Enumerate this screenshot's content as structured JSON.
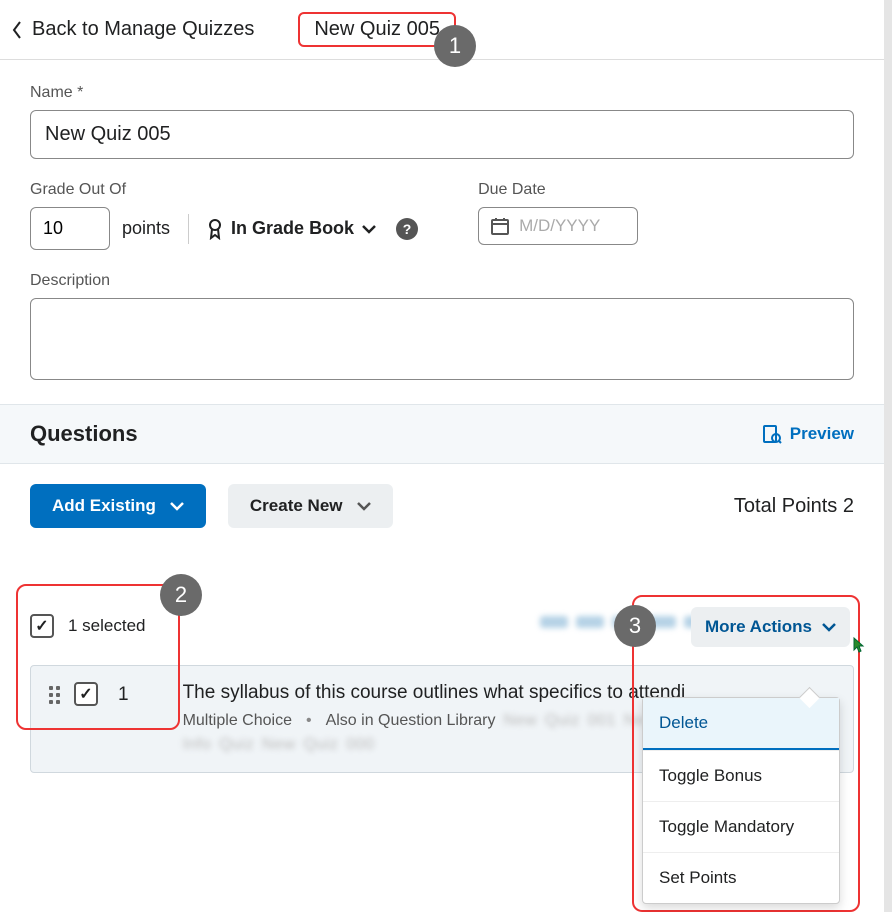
{
  "topbar": {
    "back_label": "Back to Manage Quizzes",
    "quiz_title": "New Quiz 005"
  },
  "form": {
    "name_label": "Name *",
    "name_value": "New Quiz 005",
    "grade_label": "Grade Out Of",
    "grade_value": "10",
    "points_text": "points",
    "gradebook_label": "In Grade Book",
    "due_label": "Due Date",
    "due_placeholder": "M/D/YYYY",
    "desc_label": "Description"
  },
  "questions_section": {
    "heading": "Questions",
    "preview_label": "Preview",
    "add_existing_label": "Add Existing",
    "create_new_label": "Create New",
    "total_points_text": "Total Points 2",
    "selected_text": "1 selected",
    "more_actions_label": "More Actions"
  },
  "question": {
    "number": "1",
    "text": "The syllabus of this course outlines what specifics to attendi",
    "type_label": "Multiple Choice",
    "library_label": "Also in Question Library"
  },
  "dropdown": {
    "items": [
      "Delete",
      "Toggle Bonus",
      "Toggle Mandatory",
      "Set Points"
    ]
  },
  "annotations": {
    "one": "1",
    "two": "2",
    "three": "3"
  }
}
